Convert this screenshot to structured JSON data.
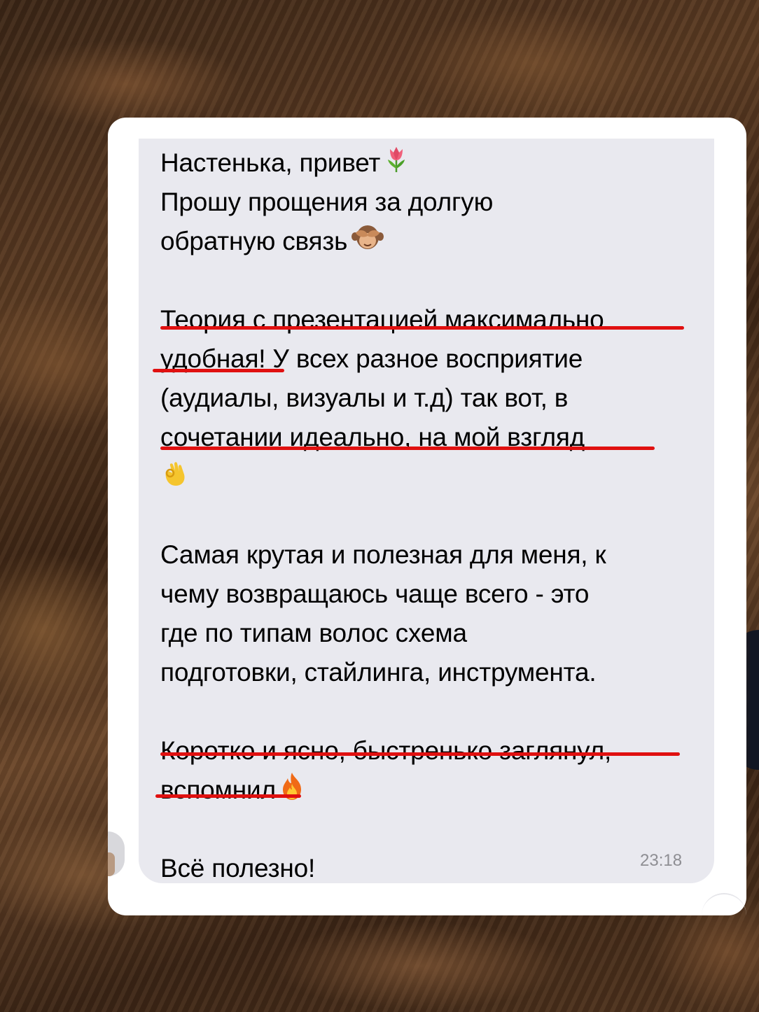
{
  "message": {
    "p1": {
      "l1": "Настенька, привет",
      "l2": "Прошу прощения за долгую",
      "l3": "обратную связь"
    },
    "p2": {
      "l1": "Теория с презентацией максимально",
      "l2": "удобная! У всех разное восприятие",
      "l3": "(аудиалы, визуалы и т.д) так вот, в",
      "l4": "сочетании идеально, на мой взгляд"
    },
    "p3": {
      "l1": "Самая крутая и полезная для меня, к",
      "l2": "чему возвращаюсь чаще всего - это",
      "l3": "где по типам волос схема",
      "l4": "подготовки, стайлинга, инструмента."
    },
    "p4": {
      "l1": "Коротко и ясно, быстренько заглянул,",
      "l2": "вспомнил"
    },
    "p5": {
      "l1": "Всё полезно!"
    },
    "time": "23:18"
  },
  "emojis": [
    "tulip-emoji",
    "see-no-evil-monkey-emoji",
    "ok-hand-emoji",
    "fire-emoji"
  ],
  "colors": {
    "bubble": "#e9e9ef",
    "card": "#ffffff",
    "underline": "#e01010",
    "timestamp": "#8e8e93",
    "text": "#000000"
  }
}
